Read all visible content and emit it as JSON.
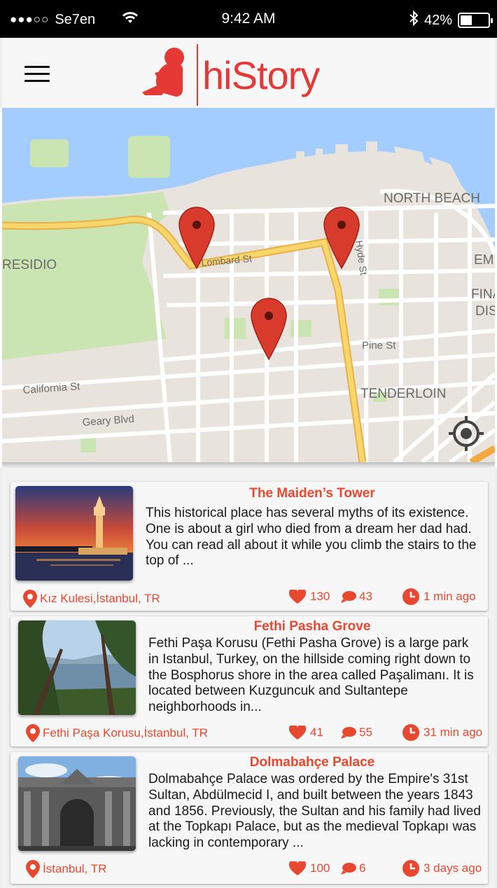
{
  "status_bar": {
    "signal_dots": "●●●○○",
    "carrier": "Se7en",
    "time": "9:42 AM",
    "battery": "42%",
    "battery_level": 0.42,
    "icons": [
      "wifi-icon",
      "bluetooth-icon",
      "battery-icon"
    ]
  },
  "header": {
    "logo_text": "hiStory",
    "brand_color": "#e53935"
  },
  "map": {
    "labels": {
      "north_beach": "NORTH BEACH",
      "presidio": "RESIDIO",
      "lombard": "Lombard St",
      "hyde": "Hyde St",
      "pine": "Pine St",
      "california": "California St",
      "geary": "Geary Blvd",
      "tenderloin": "TENDERLOIN",
      "emb": "EMB",
      "fina": "FINA",
      "dis": "DIS"
    }
  },
  "places": [
    {
      "title": "The Maiden’s Tower",
      "description": "This historical place has several myths of its existence. One is about a girl who died from a dream her dad had. You can read all about it while you climb the stairs to the top of ...",
      "location": "Kız Kulesi,İstanbul, TR",
      "likes": "130",
      "comments": "43",
      "time": "1 min ago"
    },
    {
      "title": "Fethi Pasha Grove",
      "description": "Fethi Paşa Korusu (Fethi Pasha Grove) is a large park in Istanbul, Turkey, on the hillside coming right down to the Bosphorus shore in the area called Paşalimanı. It is located between Kuzguncuk and Sultantepe neighborhoods in...",
      "location": "Fethi Paşa Korusu,İstanbul, TR",
      "likes": "41",
      "comments": "55",
      "time": "31 min ago"
    },
    {
      "title": "Dolmabahçe Palace",
      "description": "Dolmabahçe Palace was ordered by the Empire's 31st Sultan, Abdülmecid I, and built between the years 1843 and 1856. Previously, the Sultan and his family had lived at the Topkapı Palace, but as the medieval Topkapı was lacking in contemporary ...",
      "location": "İstanbul, TR",
      "likes": "100",
      "comments": "6",
      "time": "3 days ago"
    }
  ],
  "colors": {
    "accent": "#e8482f",
    "map_water": "#a3ccff",
    "map_park": "#cae4b2",
    "map_road_major": "#f8d66a",
    "map_land": "#e8e4dd"
  }
}
